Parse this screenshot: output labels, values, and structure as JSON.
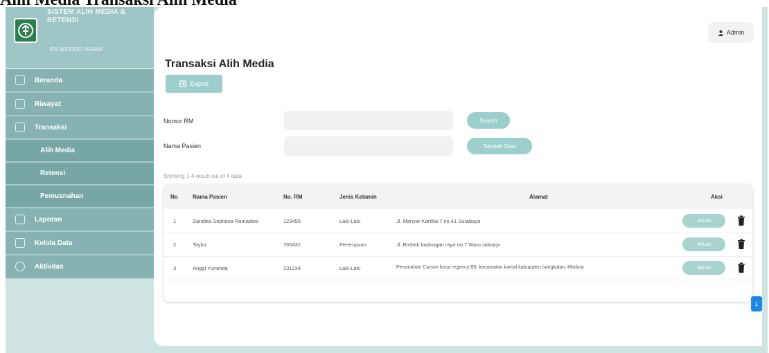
{
  "caption": "Alih Media Transaksi Alih Media",
  "app": {
    "title": "SISTEM ALIH MEDIA & RETENSI",
    "subtitle": "RS WIDODO NGAWI"
  },
  "sidebar": {
    "items": [
      {
        "label": "Beranda",
        "icon": "home-icon"
      },
      {
        "label": "Riwayat",
        "icon": "document-icon"
      },
      {
        "label": "Transaksi",
        "icon": "transaction-icon"
      },
      {
        "label": "Alih Media",
        "sub": true
      },
      {
        "label": "Retensi",
        "sub": true
      },
      {
        "label": "Pemusnahan",
        "sub": true
      },
      {
        "label": "Laporan",
        "icon": "report-icon"
      },
      {
        "label": "Kelola Data",
        "icon": "data-icon"
      },
      {
        "label": "Aktivitas",
        "icon": "activity-icon"
      }
    ]
  },
  "header": {
    "user_label": "Admin"
  },
  "main": {
    "title": "Transaksi Alih Media",
    "export_label": "Export",
    "filters": {
      "rm_label": "Nomor RM",
      "name_label": "Nama Pasien",
      "search_label": "Search",
      "add_label": "Tambah Data"
    },
    "showing": "Showing 1-4 result out of 4 data",
    "table": {
      "headers": [
        "No",
        "Nama Pasien",
        "No. RM",
        "Jenis Kelamin",
        "Alamat",
        "Aksi"
      ],
      "rows": [
        {
          "no": "1",
          "nama": "Sandika Septiana Ramadani",
          "rm": "123456",
          "jk": "Laki-Laki",
          "alamat": "Jl. Manyar Kartika 7 no.41 Surabaya",
          "aksi": "Aktual"
        },
        {
          "no": "2",
          "nama": "Taylor",
          "rm": "765432",
          "jk": "Perempuan",
          "alamat": "Jl. Brebek badongan raya no.7 Waru sidoarjo",
          "aksi": "Aktual"
        },
        {
          "no": "3",
          "nama": "Anggi Yunanda",
          "rm": "231234",
          "jk": "Laki-Laki",
          "alamat": "Perumahan Carson forsa regency B6, kecamatan kamal kabupaten bangkalan, Madura",
          "aksi": "Aktual"
        }
      ]
    },
    "pagination": {
      "current": "1"
    }
  },
  "colors": {
    "sidebar": "#86b3b1",
    "sidebar_sub": "#76a7a5",
    "accent": "#9ccfcb",
    "page_active": "#1e88e5"
  }
}
